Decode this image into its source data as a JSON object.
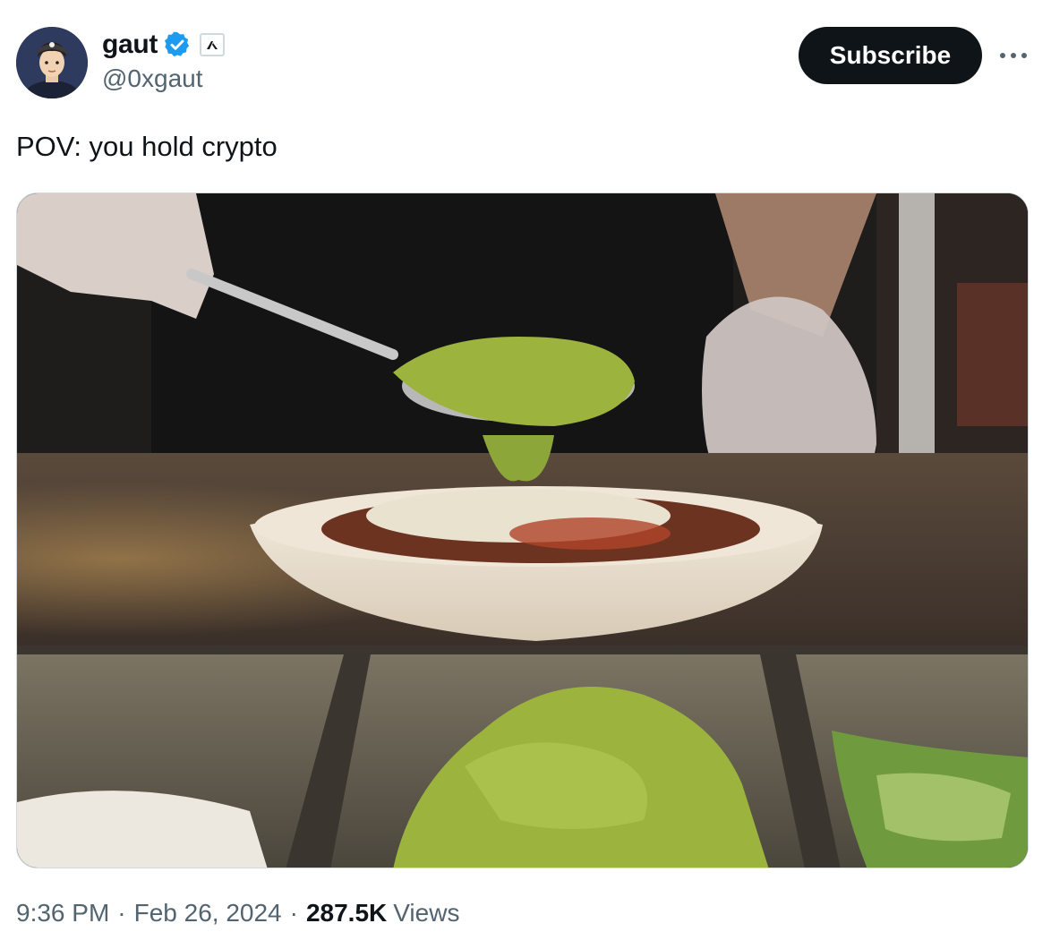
{
  "author": {
    "display_name": "gaut",
    "handle": "@0xgaut",
    "verified": true,
    "avatar_icon": "cartoon-avatar",
    "affiliation_icon": "affiliate-badge-icon"
  },
  "actions": {
    "subscribe_label": "Subscribe",
    "more_icon": "more-options-icon"
  },
  "tweet": {
    "text": "POV: you hold crypto",
    "media_description_icon": "burrito-bowl-photo"
  },
  "meta": {
    "time": "9:36 PM",
    "separator": "·",
    "date": "Feb 26, 2024",
    "views_count": "287.5K",
    "views_label": "Views"
  },
  "colors": {
    "verified_blue": "#1d9bf0",
    "subscribe_bg": "#0f1419",
    "secondary_text": "#536471",
    "guacamole": "#9cb33e"
  }
}
